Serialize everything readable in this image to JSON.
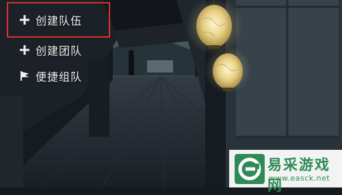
{
  "menu": {
    "items": [
      {
        "label": "创建队伍",
        "icon": "plus-icon",
        "highlighted": true
      },
      {
        "label": "创建团队",
        "icon": "plus-icon",
        "highlighted": false
      },
      {
        "label": "便捷组队",
        "icon": "flag-icon",
        "highlighted": false
      }
    ],
    "highlight_color": "#d8322e"
  },
  "watermark": {
    "name": "易采游戏网",
    "url": "www.easck.net",
    "color": "#2f8a57"
  }
}
